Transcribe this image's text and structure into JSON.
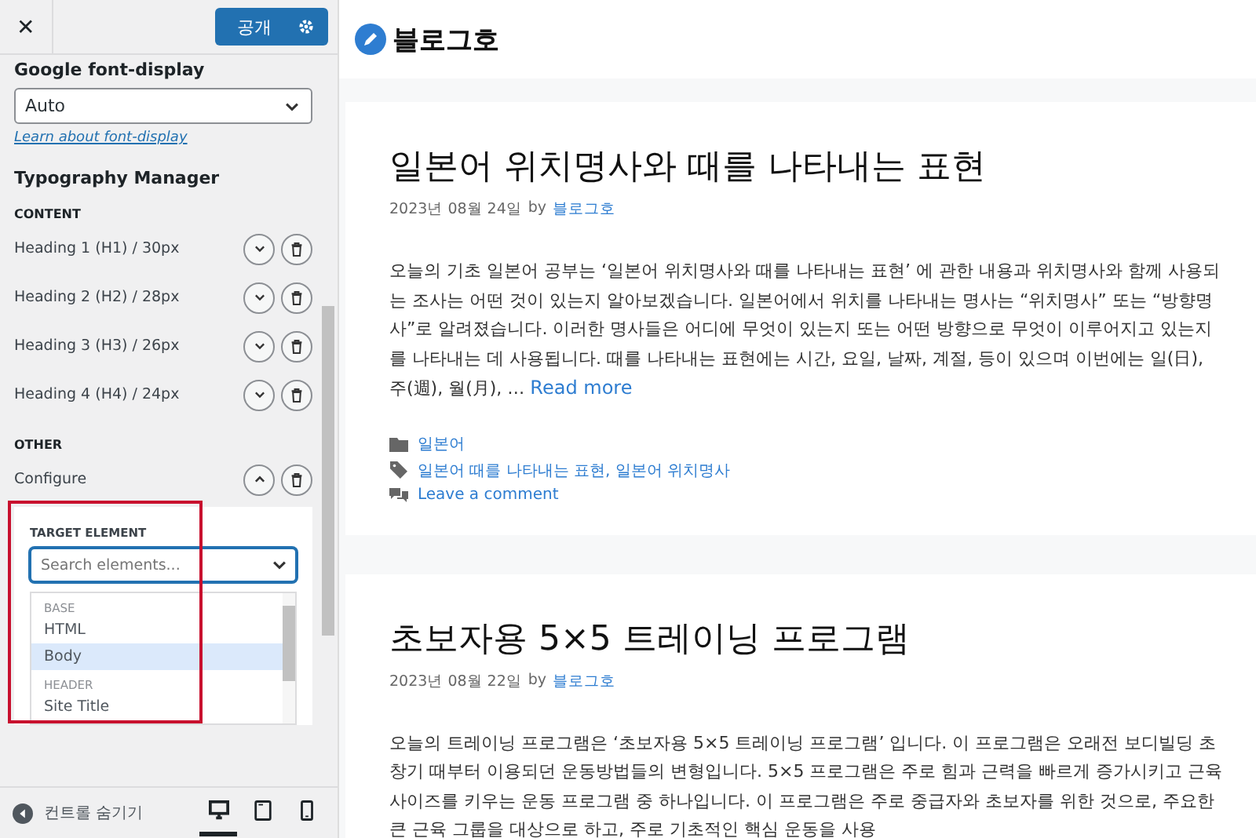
{
  "sidebar": {
    "close": "✕",
    "publish_button": "공개",
    "font_display": {
      "label": "Google font-display",
      "value": "Auto",
      "link": "Learn about font-display"
    },
    "section_title": "Typography Manager",
    "groups": [
      {
        "title": "CONTENT",
        "items": [
          {
            "label": "Heading 1 (H1) / 30px",
            "expanded": false
          },
          {
            "label": "Heading 2 (H2) / 28px",
            "expanded": false
          },
          {
            "label": "Heading 3 (H3) / 26px",
            "expanded": false
          },
          {
            "label": "Heading 4 (H4) / 24px",
            "expanded": false
          }
        ]
      },
      {
        "title": "OTHER",
        "items": [
          {
            "label": "Configure",
            "expanded": true
          }
        ]
      }
    ],
    "config_panel": {
      "label": "TARGET ELEMENT",
      "search": {
        "placeholder": "Search elements..."
      },
      "options": [
        {
          "kind": "group",
          "label": "BASE"
        },
        {
          "kind": "option",
          "label": "HTML",
          "selected": false
        },
        {
          "kind": "option",
          "label": "Body",
          "selected": true
        },
        {
          "kind": "group",
          "label": "HEADER"
        },
        {
          "kind": "option",
          "label": "Site Title",
          "selected": false
        }
      ]
    },
    "footer": {
      "hide_controls": "컨트롤 숨기기",
      "devices": [
        {
          "kind": "desktop",
          "selected": true
        },
        {
          "kind": "tablet",
          "selected": false
        },
        {
          "kind": "mobile",
          "selected": false
        }
      ]
    }
  },
  "preview": {
    "site_title": "블로그호",
    "posts": [
      {
        "title": "일본어 위치명사와 때를 나타내는 표현",
        "date": "2023년 08월 24일",
        "by": "by",
        "author": "블로그호",
        "excerpt": "오늘의 기초 일본어 공부는 ‘일본어 위치명사와 때를 나타내는 표현’ 에 관한 내용과 위치명사와 함께 사용되는 조사는 어떤 것이 있는지 알아보겠습니다. 일본어에서 위치를 나타내는 명사는 “위치명사” 또는 “방향명사”로 알려졌습니다. 이러한 명사들은 어디에 무엇이 있는지 또는 어떤 방향으로 무엇이 이루어지고 있는지를 나타내는 데 사용됩니다. 때를 나타내는 표현에는 시간, 요일, 날짜, 계절, 등이 있으며 이번에는 일(日), 주(週), 월(月), …",
        "read_more": "Read more",
        "category": "일본어",
        "tags": "일본어 때를 나타내는 표현, 일본어 위치명사",
        "comment": "Leave a comment"
      },
      {
        "title": "초보자용 5×5 트레이닝 프로그램",
        "date": "2023년 08월 22일",
        "by": "by",
        "author": "블로그호",
        "excerpt": "오늘의 트레이닝 프로그램은 ‘초보자용 5×5 트레이닝 프로그램’ 입니다. 이 프로그램은 오래전 보디빌딩 초창기 때부터 이용되던 운동방법들의 변형입니다. 5×5 프로그램은 주로 힘과 근력을 빠르게 증가시키고 근육 사이즈를 키우는 운동 프로그램 중 하나입니다. 이 프로그램은 주로 중급자와 초보자를 위한 것으로, 주요한 큰 근육 그룹을 대상으로 하고, 주로 기초적인 핵심 운동을 사용"
      }
    ]
  }
}
